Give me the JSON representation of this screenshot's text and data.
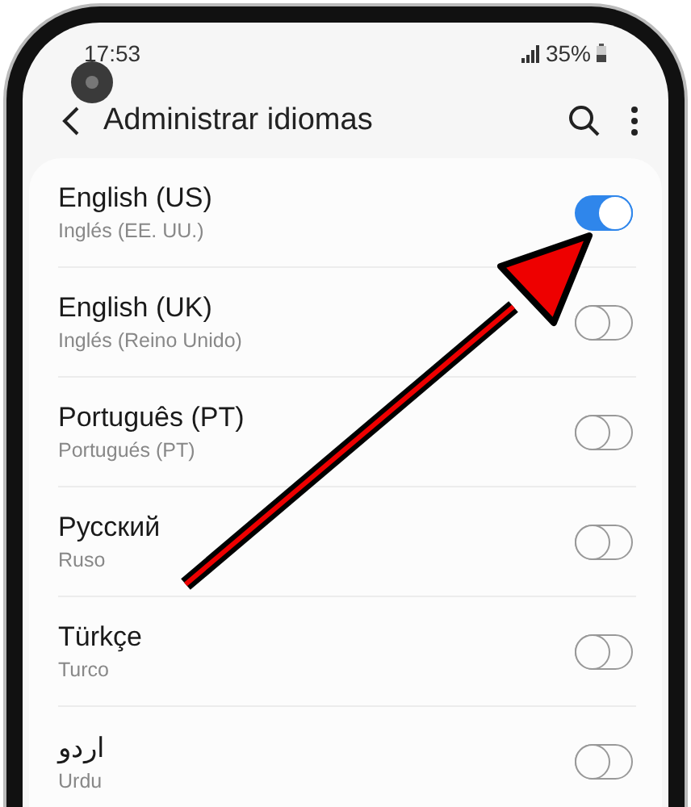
{
  "status_bar": {
    "time": "17:53",
    "battery": "35%"
  },
  "app_bar": {
    "title": "Administrar idiomas"
  },
  "languages": [
    {
      "name": "English (US)",
      "subtitle": "Inglés (EE. UU.)",
      "on": true
    },
    {
      "name": "English (UK)",
      "subtitle": "Inglés (Reino Unido)",
      "on": false
    },
    {
      "name": "Português (PT)",
      "subtitle": "Portugués (PT)",
      "on": false
    },
    {
      "name": "Русский",
      "subtitle": "Ruso",
      "on": false
    },
    {
      "name": "Türkçe",
      "subtitle": "Turco",
      "on": false
    },
    {
      "name": "اردو",
      "subtitle": "Urdu",
      "on": false
    }
  ]
}
